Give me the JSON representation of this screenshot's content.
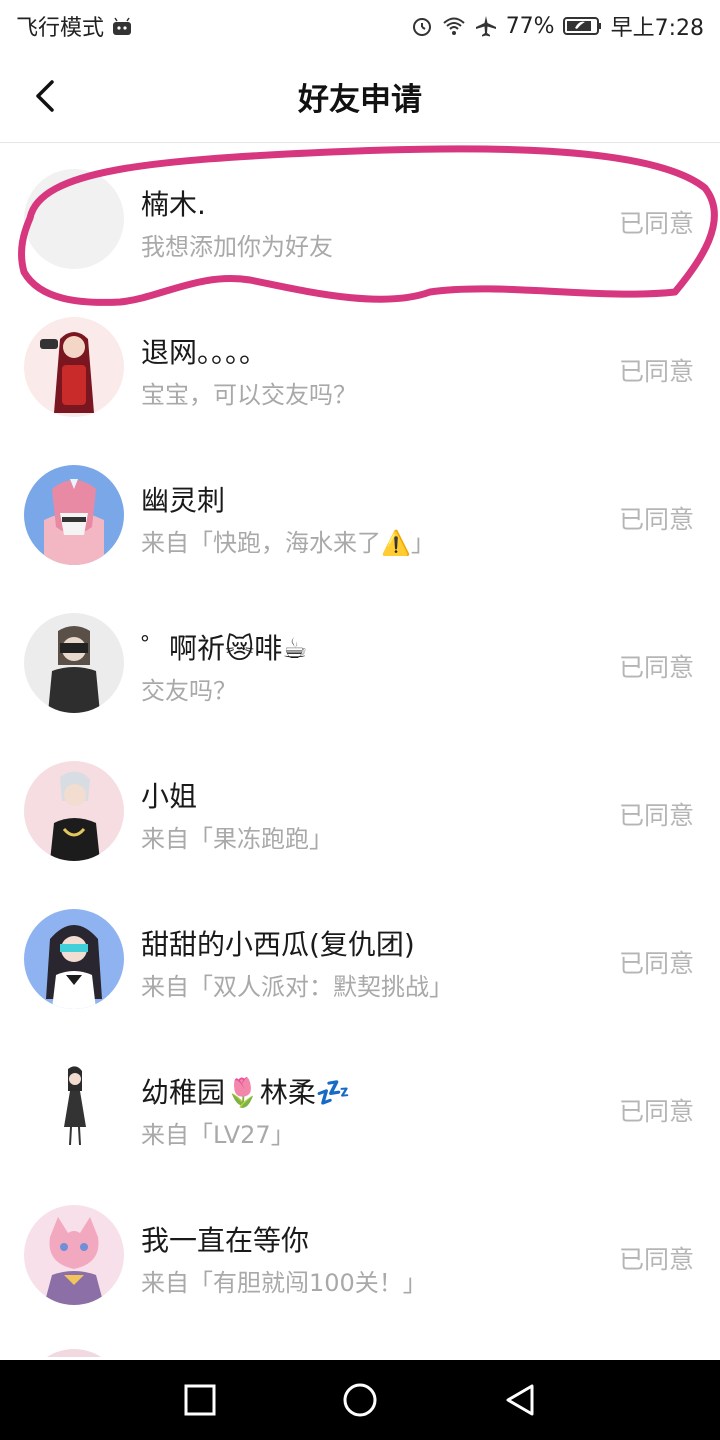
{
  "status_bar": {
    "airplane_mode_label": "飞行模式",
    "battery": "77%",
    "time": "早上7:28",
    "icons": [
      "android-icon",
      "alarm-icon",
      "wifi-icon",
      "airplane-icon",
      "battery-icon"
    ]
  },
  "header": {
    "title": "好友申请",
    "back_icon": "back-chevron-icon"
  },
  "requests": [
    {
      "name": "楠木.",
      "message": "我想添加你为好友",
      "status": "已同意"
    },
    {
      "name": "退网。。。。",
      "message": "宝宝，可以交友吗？",
      "status": "已同意"
    },
    {
      "name": "幽灵刺",
      "message": "来自「快跑，海水来了⚠️」",
      "status": "已同意"
    },
    {
      "name": "゜啊祈😿啡☕",
      "message": "交友吗？",
      "status": "已同意"
    },
    {
      "name": "小姐",
      "message": "来自「果冻跑跑」",
      "status": "已同意"
    },
    {
      "name": "甜甜的小西瓜(复仇团)",
      "message": "来自「双人派对：默契挑战」",
      "status": "已同意"
    },
    {
      "name": "幼稚园🌷林柔💤",
      "message": "来自「LV27」",
      "status": "已同意"
    },
    {
      "name": "我一直在等你",
      "message": "来自「有胆就闯100关！」",
      "status": "已同意"
    }
  ],
  "colors": {
    "highlight_stroke": "#d6377f",
    "secondary_text": "#a9a9a9",
    "status_text": "#b5b5b5"
  },
  "bottom_nav": [
    "recents-square-icon",
    "home-circle-icon",
    "back-triangle-icon"
  ]
}
